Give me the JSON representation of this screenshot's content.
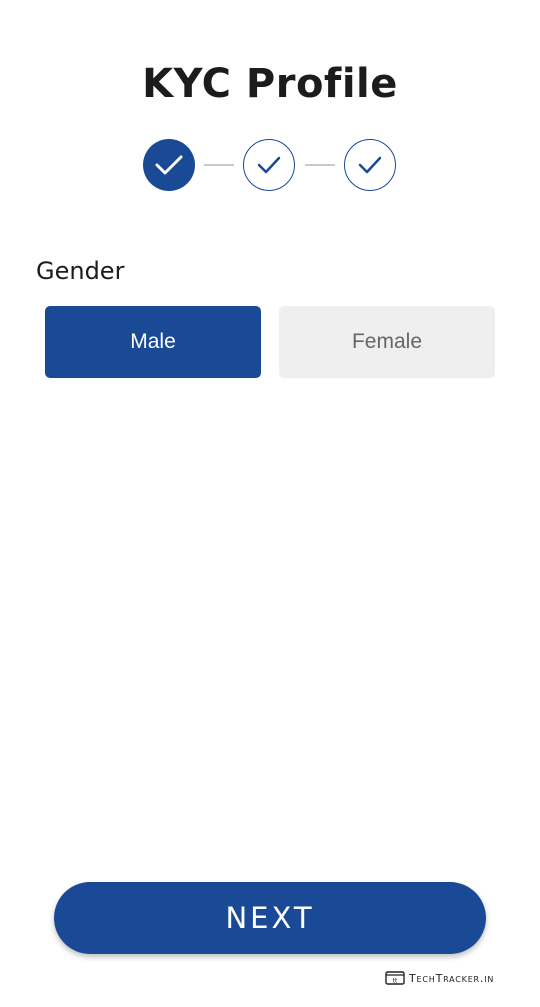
{
  "page": {
    "title": "KYC Profile"
  },
  "stepper": {
    "steps": [
      {
        "state": "completed-active",
        "icon": "check-icon"
      },
      {
        "state": "completed",
        "icon": "check-icon"
      },
      {
        "state": "completed",
        "icon": "check-icon"
      }
    ]
  },
  "gender": {
    "label": "Gender",
    "options": [
      "Male",
      "Female"
    ],
    "selected": "Male"
  },
  "actions": {
    "next_label": "NEXT"
  },
  "watermark": {
    "text": "TechTracker.in"
  },
  "colors": {
    "primary": "#1a4a96",
    "unselected_bg": "#efefef",
    "unselected_text": "#666666",
    "connector": "#c9c9c9"
  }
}
